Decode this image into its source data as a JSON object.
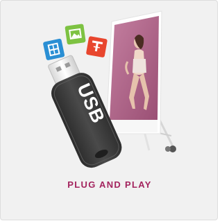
{
  "card": {
    "caption": "PLUG AND PLAY"
  },
  "usb_drive": {
    "label": "USB"
  },
  "icons": [
    {
      "name": "film-icon",
      "color": "#2a8fd4"
    },
    {
      "name": "image-icon",
      "color": "#7dc242"
    },
    {
      "name": "text-icon",
      "color": "#e8462e"
    }
  ],
  "colors": {
    "caption": "#a3245e",
    "background": "#f1f1f1",
    "usb_body": "#3b3b3b",
    "display_screen": "#b06a8d"
  }
}
